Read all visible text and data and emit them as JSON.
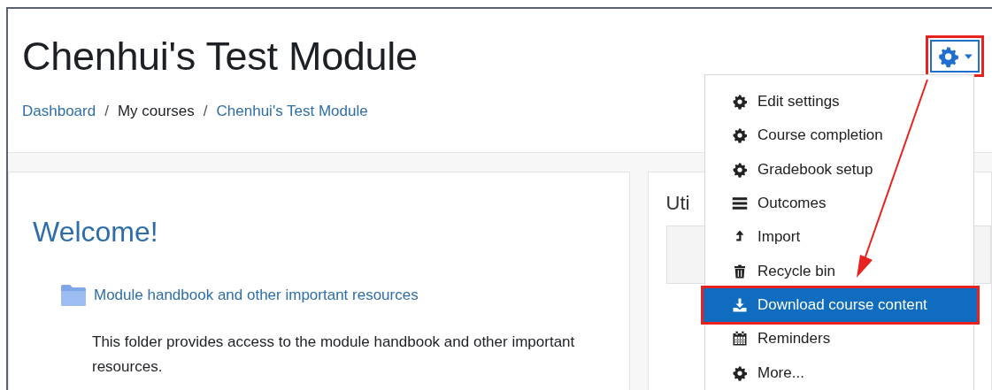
{
  "header": {
    "title": "Chenhui's Test Module",
    "breadcrumbs": [
      {
        "label": "Dashboard",
        "kind": "link"
      },
      {
        "label": "My courses",
        "kind": "text"
      },
      {
        "label": "Chenhui's Test Module",
        "kind": "link"
      }
    ],
    "separator": "/"
  },
  "main": {
    "heading": "Welcome!",
    "resource": {
      "link": "Module handbook and other important resources",
      "description": "This folder provides access to the module handbook and other important resources."
    }
  },
  "side_block": {
    "title": "Uti"
  },
  "menu": {
    "items": [
      {
        "label": "Edit settings",
        "kind": "gear",
        "selected": false
      },
      {
        "label": "Course completion",
        "kind": "gear",
        "selected": false
      },
      {
        "label": "Gradebook setup",
        "kind": "gear",
        "selected": false
      },
      {
        "label": "Outcomes",
        "kind": "list",
        "selected": false
      },
      {
        "label": "Import",
        "kind": "import",
        "selected": false
      },
      {
        "label": "Recycle bin",
        "kind": "trash",
        "selected": false
      },
      {
        "label": "Download course content",
        "kind": "download",
        "selected": true
      },
      {
        "label": "Reminders",
        "kind": "calendar",
        "selected": false
      },
      {
        "label": "More...",
        "kind": "gear",
        "selected": false
      }
    ]
  }
}
